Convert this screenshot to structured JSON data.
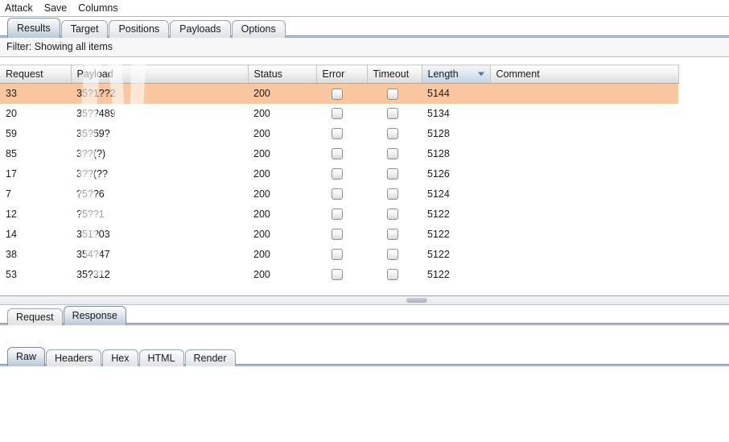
{
  "menu": {
    "items": [
      {
        "label": "Attack"
      },
      {
        "label": "Save"
      },
      {
        "label": "Columns"
      }
    ]
  },
  "main_tabs": {
    "selected": "Results",
    "items": [
      {
        "label": "Results",
        "selected": true
      },
      {
        "label": "Target",
        "selected": false
      },
      {
        "label": "Positions",
        "selected": false
      },
      {
        "label": "Payloads",
        "selected": false
      },
      {
        "label": "Options",
        "selected": false
      }
    ]
  },
  "filter": {
    "label": "Filter:",
    "status": "Showing all items",
    "text": "Filter: Showing all items"
  },
  "results_table": {
    "columns": [
      {
        "label": "Request",
        "sorted": false
      },
      {
        "label": "Payload",
        "sorted": false
      },
      {
        "label": "Status",
        "sorted": false
      },
      {
        "label": "Error",
        "sorted": false
      },
      {
        "label": "Timeout",
        "sorted": false
      },
      {
        "label": "Length",
        "sorted": true,
        "sort_direction": "descending"
      },
      {
        "label": "Comment",
        "sorted": false
      }
    ],
    "selected_row_color": "#fac7a0",
    "rows": [
      {
        "request": "33",
        "payload": "35?1??2",
        "status": "200",
        "error": false,
        "timeout": false,
        "length": "5144",
        "comment": "",
        "selected": true
      },
      {
        "request": "20",
        "payload": "35??489",
        "status": "200",
        "error": false,
        "timeout": false,
        "length": "5134",
        "comment": "",
        "selected": false
      },
      {
        "request": "59",
        "payload": "35?59?",
        "status": "200",
        "error": false,
        "timeout": false,
        "length": "5128",
        "comment": "",
        "selected": false
      },
      {
        "request": "85",
        "payload": "3??(?)",
        "status": "200",
        "error": false,
        "timeout": false,
        "length": "5128",
        "comment": "",
        "selected": false
      },
      {
        "request": "17",
        "payload": "3??(??",
        "status": "200",
        "error": false,
        "timeout": false,
        "length": "5126",
        "comment": "",
        "selected": false
      },
      {
        "request": "7",
        "payload": "?5??6",
        "status": "200",
        "error": false,
        "timeout": false,
        "length": "5124",
        "comment": "",
        "selected": false
      },
      {
        "request": "12",
        "payload": "?5??1",
        "status": "200",
        "error": false,
        "timeout": false,
        "length": "5122",
        "comment": "",
        "selected": false
      },
      {
        "request": "14",
        "payload": "351?03",
        "status": "200",
        "error": false,
        "timeout": false,
        "length": "5122",
        "comment": "",
        "selected": false
      },
      {
        "request": "38",
        "payload": "354?47",
        "status": "200",
        "error": false,
        "timeout": false,
        "length": "5122",
        "comment": "",
        "selected": false
      },
      {
        "request": "53",
        "payload": "35?312",
        "status": "200",
        "error": false,
        "timeout": false,
        "length": "5122",
        "comment": "",
        "selected": false
      }
    ]
  },
  "message_tabs": {
    "selected": "Response",
    "items": [
      {
        "label": "Request",
        "selected": false
      },
      {
        "label": "Response",
        "selected": true
      }
    ]
  },
  "view_tabs": {
    "selected": "Raw",
    "items": [
      {
        "label": "Raw",
        "selected": true
      },
      {
        "label": "Headers",
        "selected": false
      },
      {
        "label": "Hex",
        "selected": false
      },
      {
        "label": "HTML",
        "selected": false
      },
      {
        "label": "Render",
        "selected": false
      }
    ]
  }
}
